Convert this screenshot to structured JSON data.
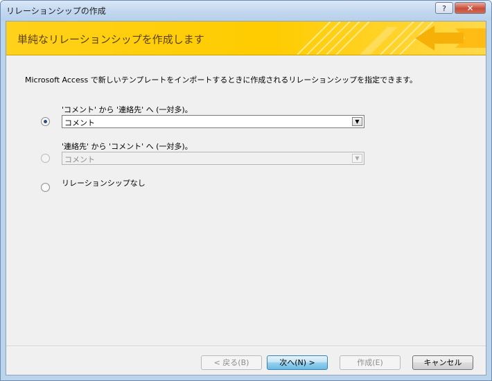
{
  "window": {
    "title": "リレーションシップの作成",
    "help_label": "?",
    "close_label": "✕"
  },
  "banner": {
    "title": "単純なリレーションシップを作成します"
  },
  "description": "Microsoft Access で新しいテンプレートをインポートするときに作成されるリレーションシップを指定できます。",
  "options": [
    {
      "label": "'コメント' から '連絡先' へ (一対多)。",
      "selected": true,
      "combo_value": "コメント",
      "enabled": true
    },
    {
      "label": "'連絡先' から 'コメント' へ (一対多)。",
      "selected": false,
      "combo_value": "コメント",
      "enabled": false
    },
    {
      "label": "リレーションシップなし",
      "selected": false,
      "enabled": true
    }
  ],
  "buttons": {
    "back": "< 戻る(B)",
    "next": "次へ(N) >",
    "finish": "作成(E)",
    "cancel": "キャンセル"
  },
  "icons": {
    "combo_arrow": "▼"
  },
  "colors": {
    "banner": "#ffcc00",
    "banner_text": "#5b3f00"
  }
}
